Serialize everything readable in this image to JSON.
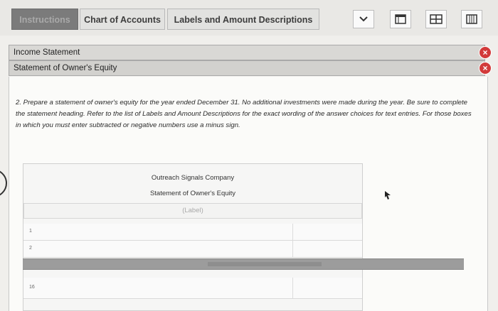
{
  "tabs": [
    {
      "label": "Instructions",
      "state": "disabled"
    },
    {
      "label": "Chart of Accounts",
      "state": "normal"
    },
    {
      "label": "Labels and Amount Descriptions",
      "state": "normal"
    }
  ],
  "toolbar_icons": [
    "chevron-down-icon",
    "worksheet-icon",
    "split-view-icon",
    "list-view-icon"
  ],
  "subtabs": [
    {
      "label": "Income Statement"
    },
    {
      "label": "Statement of Owner's Equity"
    }
  ],
  "instructions": "2. Prepare a statement of owner's equity for the year ended December 31. No additional investments were made during the year. Be sure to complete the statement heading. Refer to the list of Labels and Amount Descriptions for the exact wording of the answer choices for text entries. For those boxes in which you must enter subtracted or negative numbers use a minus sign.",
  "statement": {
    "company": "Outreach Signals Company",
    "title": "Statement of Owner's Equity",
    "label_placeholder": "(Label)",
    "row_numbers": [
      "1",
      "2",
      "16"
    ]
  },
  "colors": {
    "close_button": "#d23a3a",
    "disabled_tab": "#7b7b7b"
  }
}
